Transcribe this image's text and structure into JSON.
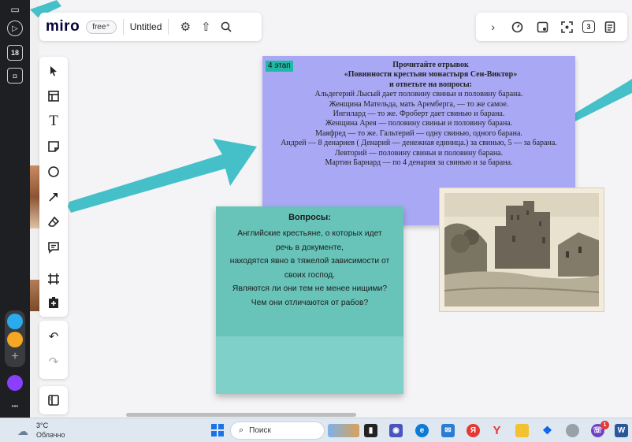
{
  "os_sidebar": {
    "badge_number": "18",
    "add_label": "+",
    "more_label": "•••",
    "colors": {
      "background": "#1e1f22",
      "telegram": "#2aabee",
      "yandex": "#f5a623",
      "alice": "#8a3ffc"
    }
  },
  "topbar": {
    "logo": "miro",
    "plan_badge": "free⁺",
    "board_title": "Untitled",
    "icons": [
      "settings-icon",
      "upload-icon",
      "search-icon"
    ]
  },
  "right_toolbar": {
    "icons": [
      "chevron-right-icon",
      "timer-icon",
      "card-icon",
      "focus-icon",
      "reactions-icon",
      "notes-icon"
    ],
    "counter_label": "3"
  },
  "tools": [
    "select-icon",
    "templates-icon",
    "text-icon",
    "sticky-note-icon",
    "shape-icon",
    "arrow-icon",
    "eraser-icon",
    "comment-icon",
    "frame-icon",
    "add-icon"
  ],
  "text_card": {
    "stage_tag": "4 этап",
    "title_lines": [
      "Прочитайте отрывок",
      "«Повинности крестьян монастыря Сен-Виктор»",
      "и ответьте на вопросы:"
    ],
    "body_lines": [
      "Альдегерий Лысый дает половину свиньи и половину барана.",
      "Женщина Мательда, мать Арембергa, — то же самое.",
      "Ингилард — то же. Фроберт дает свинью и барана.",
      "Женщина Арея — половину свиньи и половину барана.",
      "Маяфред — то же. Гальтерий — одну свинью, одного барана.",
      "Андрей — 8 денариев ( Денарий — денежная единица.) за свинью, 5 — за барана.",
      "Левторий — половину свиньи и половину барана.",
      "Мартин Барнард — по 4 денария за свинью и за барана."
    ],
    "colors": {
      "card": "#a9a8f5",
      "tag": "#1fb9a6"
    }
  },
  "sticky_note": {
    "title": "Вопросы:",
    "lines": [
      "Английские крестьяне, о которых идет",
      "речь в документе,",
      "находятся явно в тяжелой зависимости от",
      "своих господ.",
      "Являются ли они тем не менее нищими?",
      "Чем они отличаются от рабов?"
    ],
    "colors": {
      "note": "#7fd0c8",
      "note_top": "#68c3b8"
    }
  },
  "canvas": {
    "arrow_color": "#45c0c9"
  },
  "taskbar": {
    "temperature": "3°C",
    "weather": "Облачно",
    "search_placeholder": "Поиск",
    "notification_count": "1"
  }
}
